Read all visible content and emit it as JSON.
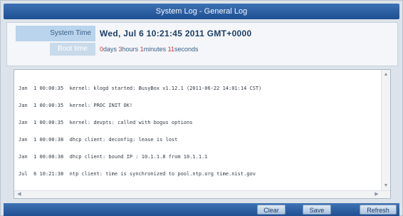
{
  "window": {
    "title": "System Log - General Log"
  },
  "info": {
    "system_time_label": "System Time",
    "system_time_value": "Wed, Jul 6  10:21:45  2011 GMT+0000",
    "uptime_label": "Boot time",
    "uptime": {
      "days_num": "0",
      "days_label": "days",
      "hours_num": "3",
      "hours_label": "hours",
      "minutes_num": "1",
      "minutes_label": "minutes",
      "seconds_num": "11",
      "seconds_label": "seconds"
    }
  },
  "log": {
    "lines": [
      "Jan  1 00:00:35  kernel: klogd started: BusyBox v1.12.1 (2011-06-22 14:01:14 CST)",
      "Jan  1 00:00:35  kernel: PROC INIT OK!",
      "Jan  1 00:00:35  kernel: devpts: called with bogus options",
      "Jan  1 00:00:38  dhcp client: deconfig: lease is lost",
      "Jan  1 00:00:38  dhcp client: bound IP : 10.1.1.8 from 10.1.1.1",
      "Jul  6 10:21:38  ntp client: time is synchronized to pool.ntp.org time.nist.gov"
    ]
  },
  "buttons": {
    "clear": "Clear",
    "save": "Save",
    "refresh": "Refresh"
  }
}
